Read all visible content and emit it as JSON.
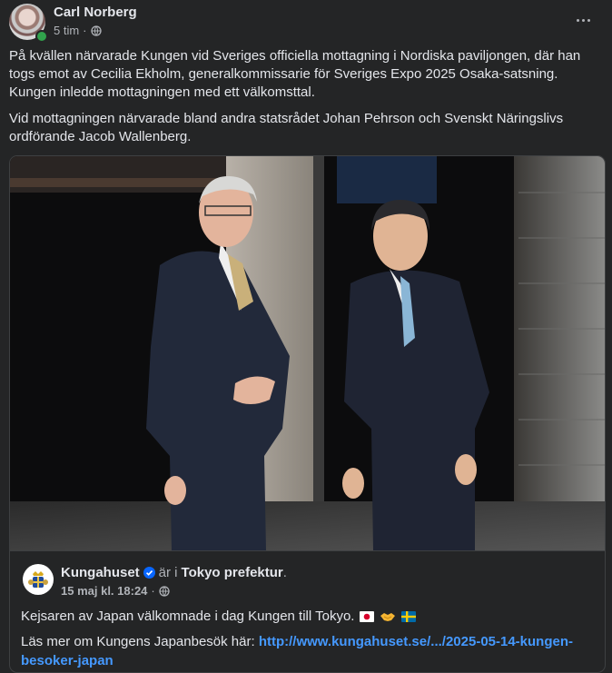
{
  "post": {
    "author": "Carl Norberg",
    "time": "5 tim",
    "separator": "·",
    "paragraphs": [
      "På kvällen närvarade Kungen vid Sveriges officiella mottagning i Nordiska paviljongen, där han togs emot av Cecilia Ekholm, generalkommissarie för Sveriges Expo 2025 Osaka-satsning. Kungen inledde mottagningen med ett välkomsttal.",
      "Vid mottagningen närvarade bland andra statsrådet Johan Pehrson och Svenskt Näringslivs ordförande Jacob Wallenberg."
    ]
  },
  "shared": {
    "page_name": "Kungahuset",
    "in_text": "är i",
    "place": "Tokyo prefektur",
    "period": ".",
    "date": "15 maj kl. 18:24",
    "separator": "·",
    "text": "Kejsaren av Japan välkomnade i dag Kungen till Tokyo.",
    "read_more": "Läs mer om Kungens Japanbesök här:",
    "link_text": "http://www.kungahuset.se/.../2025-05-14-kungen-besoker-japan"
  },
  "icons": {
    "more": "more-horizontal-icon",
    "globe": "globe-icon",
    "verified": "verified-badge-icon",
    "flags": [
      "japan-flag-icon",
      "handshake-icon",
      "sweden-flag-icon"
    ]
  },
  "colors": {
    "background": "#242526",
    "text": "#e4e6eb",
    "secondary": "#b0b3b8",
    "link": "#4599ff",
    "verified": "#0866ff",
    "online": "#31a24c"
  }
}
